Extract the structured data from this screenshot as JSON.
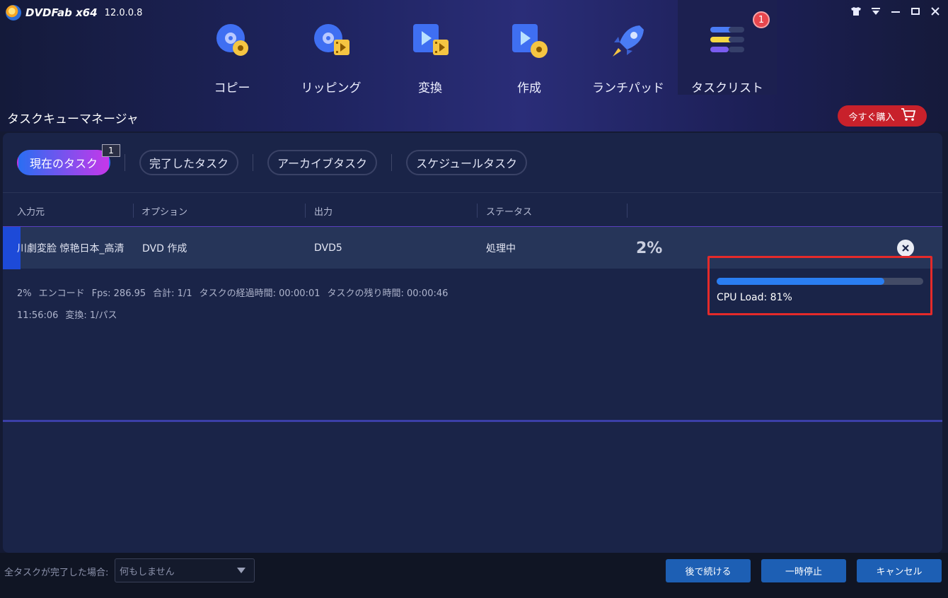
{
  "app": {
    "name": "DVDFab x64",
    "version": "12.0.0.8"
  },
  "window_controls": [
    "skin-icon",
    "menu-icon",
    "minimize-icon",
    "maximize-icon",
    "close-icon"
  ],
  "modules": [
    {
      "label": "コピー",
      "icon": "disc-icon"
    },
    {
      "label": "リッピング",
      "icon": "rip-icon"
    },
    {
      "label": "変換",
      "icon": "convert-icon"
    },
    {
      "label": "作成",
      "icon": "create-icon"
    },
    {
      "label": "ランチパッド",
      "icon": "rocket-icon"
    },
    {
      "label": "タスクリスト",
      "icon": "tasklist-icon",
      "badge": "1",
      "active": true
    }
  ],
  "section_title": "タスクキューマネージャ",
  "buy_button": "今すぐ購入",
  "tabs": [
    {
      "label": "現在のタスク",
      "badge": "1",
      "active": true
    },
    {
      "label": "完了したタスク"
    },
    {
      "label": "アーカイブタスク"
    },
    {
      "label": "スケジュールタスク"
    }
  ],
  "table": {
    "headers": [
      "入力元",
      "オプション",
      "出力",
      "ステータス"
    ],
    "row": {
      "source": "川劇変脸 惊艳日本_高清",
      "option": "DVD 作成",
      "output": "DVD5",
      "status": "処理中",
      "progress": "2%"
    }
  },
  "details": {
    "line1": [
      "2%",
      "エンコード",
      "Fps: 286.95",
      "合計: 1/1",
      "タスクの経過時間: 00:00:01",
      "タスクの残り時間: 00:00:46"
    ],
    "line2": [
      "11:56:06",
      "変換: 1/パス"
    ]
  },
  "cpu": {
    "label": "CPU Load: 81%",
    "percent": 81
  },
  "footer": {
    "when_done_label": "全タスクが完了した場合:",
    "when_done_value": "何もしません",
    "buttons": [
      "後で続ける",
      "一時停止",
      "キャンセル"
    ]
  },
  "colors": {
    "accent": "#2a6ef2",
    "buy": "#c8212b",
    "highlight_box": "#e42a2a"
  }
}
